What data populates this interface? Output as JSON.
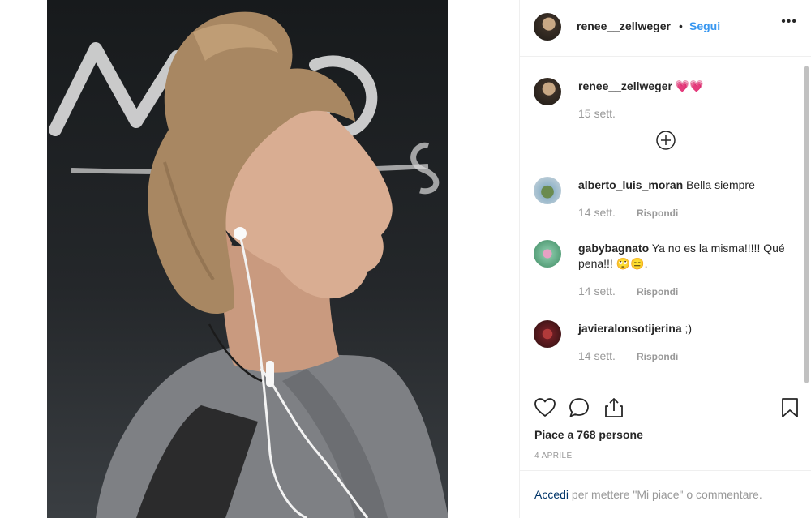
{
  "post": {
    "author": "renee__zellweger",
    "follow_label": "Segui",
    "separator": "•",
    "more_icon": "more-options-icon"
  },
  "caption": {
    "username": "renee__zellweger",
    "text": "💗💗",
    "time": "15 sett."
  },
  "load_more_icon": "plus-circle-icon",
  "comments": [
    {
      "username": "alberto_luis_moran",
      "text": "Bella siempre",
      "time": "14 sett.",
      "reply": "Rispondi"
    },
    {
      "username": "gabybagnato",
      "text": "Ya no es la misma!!!!! Qué pena!!! 🙄😑.",
      "time": "14 sett.",
      "reply": "Rispondi"
    },
    {
      "username": "javieralonsotijerina",
      "text": ";)",
      "time": "14 sett.",
      "reply": "Rispondi"
    }
  ],
  "actions": {
    "like_icon": "heart-icon",
    "comment_icon": "comment-icon",
    "share_icon": "share-icon",
    "save_icon": "bookmark-icon",
    "likes_text": "Piace a 768 persone",
    "date": "4 APRILE"
  },
  "login": {
    "link": "Accedi",
    "text": " per mettere \"Mi piace\" o commentare."
  },
  "colors": {
    "link_blue": "#3897f0",
    "text": "#262626",
    "muted": "#999999",
    "border": "#efefef",
    "login_link": "#003569"
  }
}
